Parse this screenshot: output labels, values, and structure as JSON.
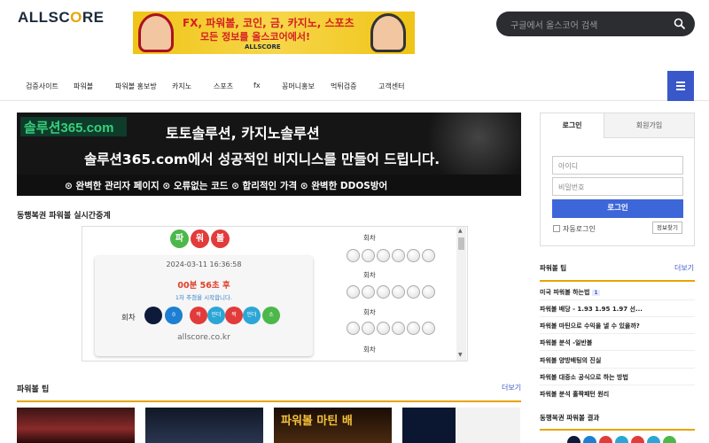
{
  "header": {
    "logo_prefix": "ALLSC",
    "logo_o": "O",
    "logo_suffix": "RE",
    "banner_line1": "FX, 파워볼, 코인, 금, 카지노, 스포츠",
    "banner_line2": "모든 정보를 올스코어에서!",
    "banner_brand": "ALLSCORE",
    "search_placeholder": "구글에서 올스코어 검색"
  },
  "nav": {
    "items": [
      "검증사이트",
      "파워볼",
      "파워볼 홍보방",
      "카지노",
      "스포츠",
      "fx",
      "꽁머니홍보",
      "먹튀검증",
      "고객센터"
    ]
  },
  "ad": {
    "site": "솔루션365.com",
    "line1": "토토솔루션, 카지노솔루션",
    "line2": "솔루션365.com에서 성공적인 비지니스를 만들어 드립니다.",
    "line3": "⊙ 완벽한 관리자 페이지  ⊙ 오류없는 코드  ⊙ 합리적인 가격  ⊙ 완벽한 DDOS방어"
  },
  "live": {
    "title": "동행복권 파워볼 실시간중계",
    "logo_chars": [
      "파",
      "워",
      "볼"
    ],
    "datetime": "2024-03-11 16:36:58",
    "countdown": "00분 56초 후",
    "message": "1차 추첨을 시작합니다.",
    "round_label": "회차",
    "balls": [
      "",
      "0",
      "짝",
      "언더",
      "짝",
      "언더",
      "소"
    ],
    "footer": "allscore.co.kr",
    "history_label": "회차"
  },
  "tips": {
    "title": "파워볼 팁",
    "more": "더보기",
    "thumbs": [
      "",
      "",
      "파워볼 마틴 배",
      ""
    ]
  },
  "login": {
    "tab_login": "로그인",
    "tab_signup": "회원가입",
    "id_placeholder": "아이디",
    "pw_placeholder": "비밀번호",
    "login_button": "로그인",
    "auto_login": "자동로그인",
    "find_info": "정보찾기"
  },
  "sidebar": {
    "tips_title": "파워볼 팁",
    "tips_more": "더보기",
    "tips": [
      "미국 파워볼 하는법",
      "파워볼 배당 - 1.93 1.95 1.97 선...",
      "파워볼 마틴으로 수익을 낼 수 있을까?",
      "파워볼 분석 -일반볼",
      "파워볼 양방배팅의 진실",
      "파워볼 대중소 공식으로 하는 방법",
      "파워볼 분석 홀짝패턴 원리"
    ],
    "badge": "1",
    "results_title": "동행복권 파워볼 결과"
  },
  "colors": {
    "accent": "#3a57c9",
    "gold": "#e7a400",
    "odd_red": "#e23b3b",
    "under_blue": "#2ba6d6",
    "small_green": "#4cb84a"
  }
}
